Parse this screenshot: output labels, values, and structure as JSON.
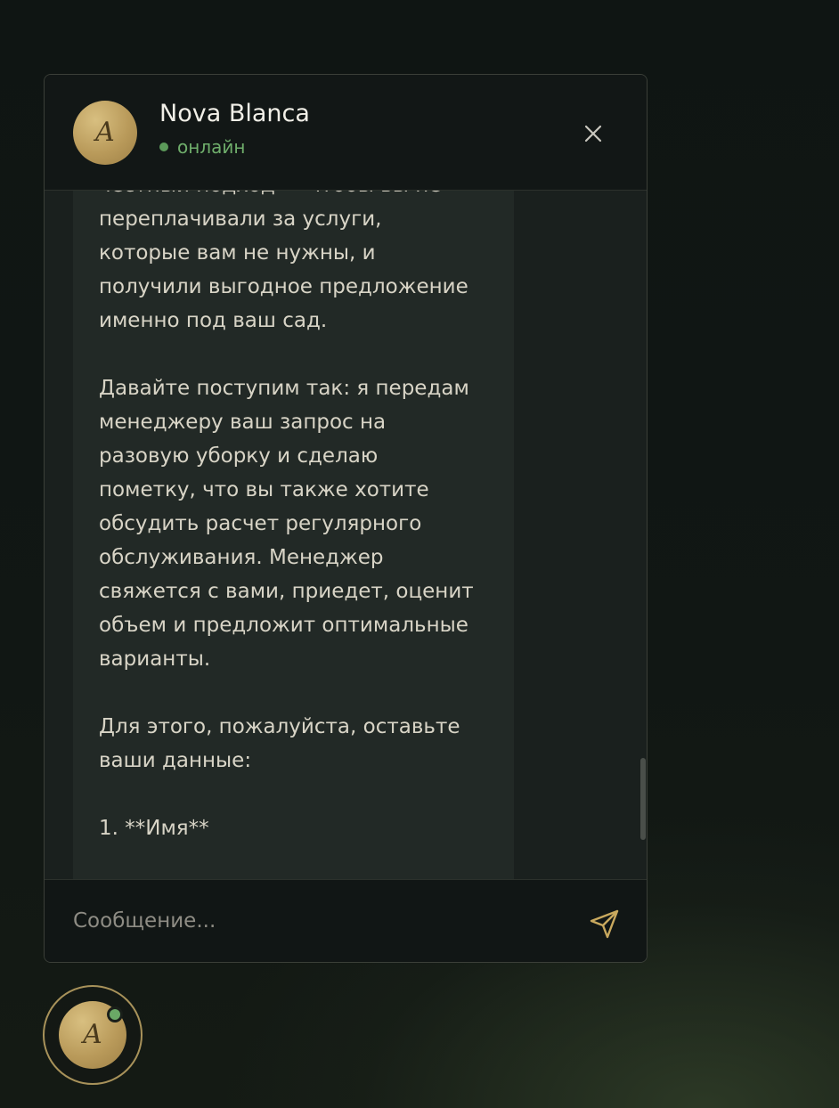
{
  "header": {
    "agent_name": "Nova Blanca",
    "avatar_initial": "A",
    "status_text": "онлайн",
    "status_color": "#5c9a5a",
    "close_icon": "close-icon"
  },
  "messages": [
    {
      "role": "bot",
      "text": "осмотра участка. Это самый\nчестный подход — чтобы вы не\nпереплачивали за услуги,\nкоторые вам не нужны, и\nполучили выгодное предложение\nименно под ваш сад.\n\nДавайте поступим так: я передам\nменеджеру ваш запрос на\nразовую уборку и сделаю\nпометку, что вы также хотите\nобсудить расчет регулярного\nобслуживания. Менеджер\nсвяжется с вами, приедет, оценит\nобъем и предложит оптимальные\nварианты.\n\nДля этого, пожалуйста, оставьте\nваши данные:\n\n1. **Имя**"
    }
  ],
  "composer": {
    "placeholder": "Сообщение...",
    "value": "",
    "send_icon": "send-icon"
  },
  "launcher": {
    "avatar_initial": "A",
    "online_indicator_color": "#6aa866"
  },
  "colors": {
    "accent_gold": "#b99a5a",
    "background": "#111714",
    "bubble_bg": "#222926",
    "text_primary": "#d8d4c6"
  }
}
